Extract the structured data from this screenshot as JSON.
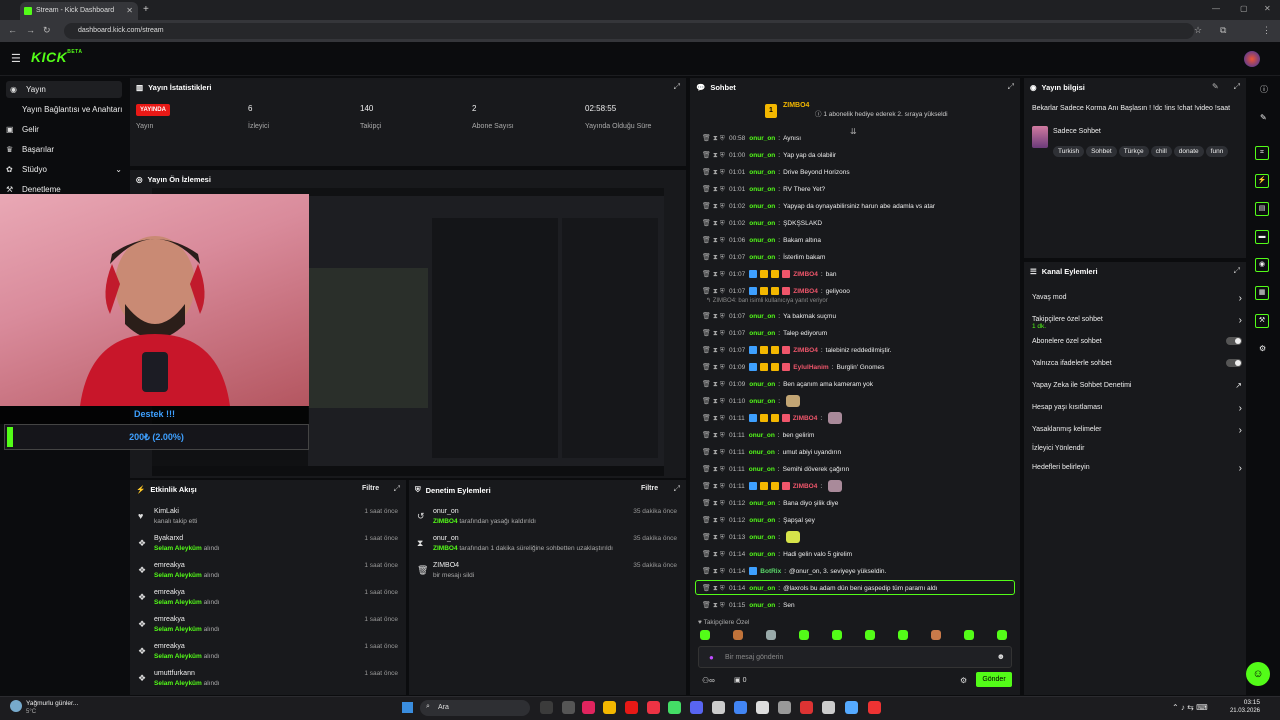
{
  "browser": {
    "tab_title": "Stream - Kick Dashboard",
    "url": "dashboard.kick.com/stream"
  },
  "header": {
    "logo": "KICK",
    "logo_badge": "BETA"
  },
  "sidebar": {
    "items": [
      {
        "label": "Yayın",
        "icon": "broadcast-icon"
      },
      {
        "label": "Yayın Bağlantısı ve Anahtarı",
        "icon": "key-icon"
      },
      {
        "label": "Gelir",
        "icon": "money-icon"
      },
      {
        "label": "Başarılar",
        "icon": "trophy-icon"
      },
      {
        "label": "Stüdyo",
        "icon": "studio-icon"
      },
      {
        "label": "Denetleme",
        "icon": "moderation-icon"
      }
    ]
  },
  "stats": {
    "title": "Yayın İstatistikleri",
    "items": [
      {
        "value": "YAYINDA",
        "label": "Yayın"
      },
      {
        "value": "6",
        "label": "İzleyici"
      },
      {
        "value": "140",
        "label": "Takipçi"
      },
      {
        "value": "2",
        "label": "Abone Sayısı"
      },
      {
        "value": "02:58:55",
        "label": "Yayında Olduğu Süre"
      }
    ]
  },
  "preview": {
    "title": "Yayın Ön İzlemesi",
    "donation_title": "Destek !!!",
    "donation_amount": "200₺ (2.00%)"
  },
  "events": {
    "title": "Etkinlik Akışı",
    "filter": "Filtre",
    "items": [
      {
        "name": "KimLaki",
        "detail_pre": "",
        "detail_strong": "",
        "detail": "kanalı takip etti",
        "time": "1 saat önce",
        "icon": "heart-icon"
      },
      {
        "name": "Byakarxd",
        "detail_strong": "Selam Aleyküm",
        "detail": " alındı",
        "time": "1 saat önce",
        "icon": "reward-icon"
      },
      {
        "name": "emreakya",
        "detail_strong": "Selam Aleyküm",
        "detail": " alındı",
        "time": "1 saat önce",
        "icon": "reward-icon"
      },
      {
        "name": "emreakya",
        "detail_strong": "Selam Aleyküm",
        "detail": " alındı",
        "time": "1 saat önce",
        "icon": "reward-icon"
      },
      {
        "name": "emreakya",
        "detail_strong": "Selam Aleyküm",
        "detail": " alındı",
        "time": "1 saat önce",
        "icon": "reward-icon"
      },
      {
        "name": "emreakya",
        "detail_strong": "Selam Aleyküm",
        "detail": " alındı",
        "time": "1 saat önce",
        "icon": "reward-icon"
      },
      {
        "name": "umuttfurkann",
        "detail_strong": "Selam Aleyküm",
        "detail": " alındı",
        "time": "1 saat önce",
        "icon": "reward-icon"
      }
    ]
  },
  "modlog": {
    "title": "Denetim Eylemleri",
    "filter": "Filtre",
    "items": [
      {
        "name": "onur_on",
        "strong": "ZIMBO4",
        "detail": " tarafından yasağı kaldırıldı",
        "time": "35 dakika önce",
        "icon": "undo-icon"
      },
      {
        "name": "onur_on",
        "strong": "ZIMBO4",
        "detail": " tarafından 1 dakika süreliğine sohbetten uzaklaştırıldı",
        "time": "35 dakika önce",
        "icon": "hourglass-icon"
      },
      {
        "name": "ZIMBO4",
        "strong": "",
        "detail": "bir mesajı sildi",
        "time": "35 dakika önce",
        "icon": "trash-icon"
      }
    ]
  },
  "chat": {
    "title": "Sohbet",
    "pinned_user": "ZIMBO4",
    "pinned_count": "1",
    "pinned_text": "1 abonelik hediye ederek 2. sıraya yükseldi",
    "reply_note": "ZIMBO4: ban isimli kullanıcıya yanıt veriyor",
    "messages": [
      {
        "time": "00:58",
        "user": "onur_on",
        "text": "Aynısı",
        "color": "green"
      },
      {
        "time": "01:00",
        "user": "onur_on",
        "text": "Yap yap da olabilir",
        "color": "green"
      },
      {
        "time": "01:01",
        "user": "onur_on",
        "text": "Drive Beyond Horizons",
        "color": "green"
      },
      {
        "time": "01:01",
        "user": "onur_on",
        "text": "RV There Yet?",
        "color": "green"
      },
      {
        "time": "01:02",
        "user": "onur_on",
        "text": "Yapyap da oynayabilirsiniz harun abe adamla vs atar",
        "color": "green"
      },
      {
        "time": "01:02",
        "user": "onur_on",
        "text": "ŞDKŞSLAKD",
        "color": "green"
      },
      {
        "time": "01:06",
        "user": "onur_on",
        "text": "Bakam altına",
        "color": "green"
      },
      {
        "time": "01:07",
        "user": "onur_on",
        "text": "İsterlim bakam",
        "color": "green"
      },
      {
        "time": "01:07",
        "user": "ZIMBO4",
        "text": "ban",
        "color": "red"
      },
      {
        "time": "01:07",
        "user": "ZIMBO4",
        "text": "geliyooo",
        "color": "red"
      },
      {
        "time": "01:07",
        "user": "onur_on",
        "text": "Ya bakmak suçmu",
        "color": "green"
      },
      {
        "time": "01:07",
        "user": "onur_on",
        "text": "Talep ediyorum",
        "color": "green"
      },
      {
        "time": "01:07",
        "user": "ZIMBO4",
        "text": "talebiniz reddedilmiştir.",
        "color": "red"
      },
      {
        "time": "01:09",
        "user": "EylulHanim",
        "text": "Burglin' Gnomes",
        "color": "red"
      },
      {
        "time": "01:09",
        "user": "onur_on",
        "text": "Ben açanım ama kameram yok",
        "color": "green"
      },
      {
        "time": "01:10",
        "user": "onur_on",
        "text": "",
        "color": "green"
      },
      {
        "time": "01:11",
        "user": "ZIMBO4",
        "text": "",
        "color": "red"
      },
      {
        "time": "01:11",
        "user": "onur_on",
        "text": "ben gelirim",
        "color": "green"
      },
      {
        "time": "01:11",
        "user": "onur_on",
        "text": "umut abiyi uyandırın",
        "color": "green"
      },
      {
        "time": "01:11",
        "user": "onur_on",
        "text": "Semihi döverek çağırın",
        "color": "green"
      },
      {
        "time": "01:11",
        "user": "ZIMBO4",
        "text": "",
        "color": "red"
      },
      {
        "time": "01:12",
        "user": "onur_on",
        "text": "Bana diyo şilik diye",
        "color": "green"
      },
      {
        "time": "01:12",
        "user": "onur_on",
        "text": "Şapşal şey",
        "color": "green"
      },
      {
        "time": "01:13",
        "user": "onur_on",
        "text": "",
        "color": "green"
      },
      {
        "time": "01:14",
        "user": "onur_on",
        "text": "Hadi gelin valo 5 girelim",
        "color": "green"
      },
      {
        "time": "01:14",
        "user": "BotRix",
        "text": "@onur_on, 3. seviyeye yükseldin.",
        "color": "green2"
      },
      {
        "time": "01:14",
        "user": "onur_on",
        "text": "@laxrols bu adam dün beni gaspedip tüm paramı aldı",
        "color": "green"
      },
      {
        "time": "01:15",
        "user": "onur_on",
        "text": "Sen",
        "color": "green"
      }
    ],
    "followers_only": "Takipçilere Özel",
    "input_placeholder": "Bir mesaj gönderin",
    "send": "Gönder",
    "count": "0"
  },
  "stream_info": {
    "title": "Yayın bilgisi",
    "stream_title": "Bekarlar Sadece Korma Anı Başlasın ! !dc !ins !chat !video !saat",
    "category": "Sadece Sohbet",
    "tags": [
      "Turkish",
      "Sohbet",
      "Türkçe",
      "chill",
      "donate",
      "funn"
    ]
  },
  "channel_actions": {
    "title": "Kanal Eylemleri",
    "items": [
      {
        "label": "Yavaş mod",
        "sub": "",
        "control": "chevron"
      },
      {
        "label": "Takipçilere özel sohbet",
        "sub": "1 dk.",
        "control": "chevron"
      },
      {
        "label": "Abonelere özel sohbet",
        "sub": "",
        "control": "toggle"
      },
      {
        "label": "Yalnızca ifadelerle sohbet",
        "sub": "",
        "control": "toggle"
      },
      {
        "label": "Yapay Zeka ile Sohbet Denetimi",
        "sub": "",
        "control": "external"
      },
      {
        "label": "Hesap yaşı kısıtlaması",
        "sub": "",
        "control": "chevron"
      },
      {
        "label": "Yasaklanmış kelimeler",
        "sub": "",
        "control": "chevron"
      },
      {
        "label": "İzleyici Yönlendir",
        "sub": "",
        "control": "none"
      },
      {
        "label": "Hedefleri belirleyin",
        "sub": "",
        "control": "chevron"
      }
    ]
  },
  "taskbar": {
    "weather": "Yağmurlu günler...",
    "temp": "5°C",
    "search": "Ara",
    "time": "03:15",
    "date": "21.03.2026"
  }
}
